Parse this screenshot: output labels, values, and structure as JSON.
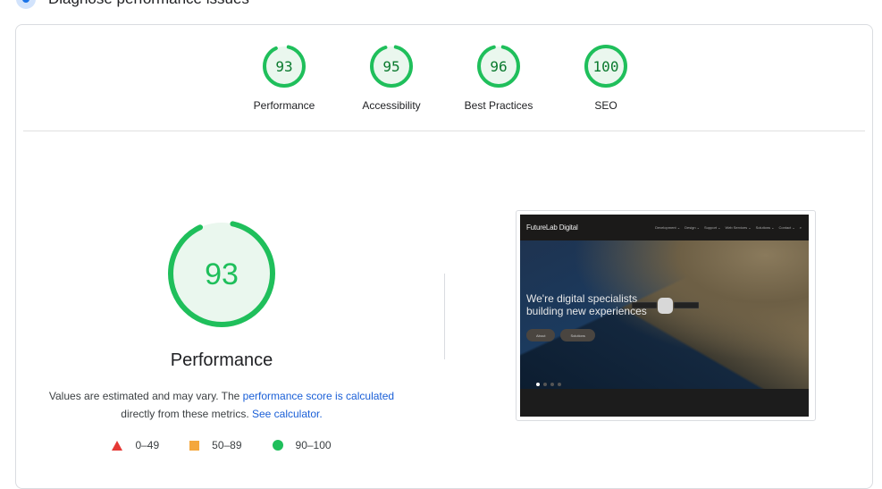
{
  "section": {
    "title": "Diagnose performance issues"
  },
  "gauges": [
    {
      "label": "Performance",
      "score": 93
    },
    {
      "label": "Accessibility",
      "score": 95
    },
    {
      "label": "Best Practices",
      "score": 96
    },
    {
      "label": "SEO",
      "score": 100
    }
  ],
  "main": {
    "score": 93,
    "label": "Performance",
    "desc_prefix": "Values are estimated and may vary. The ",
    "link1": "performance score is calculated",
    "desc_mid": "directly from these metrics. ",
    "link2": "See calculator."
  },
  "legend": [
    {
      "range": "0–49",
      "shape": "triangle",
      "color": "#e53935"
    },
    {
      "range": "50–89",
      "shape": "square",
      "color": "#f4a73c"
    },
    {
      "range": "90–100",
      "shape": "circle",
      "color": "#1fbf5b"
    }
  ],
  "colors": {
    "pass": "#1fbf5b",
    "pass_bg": "#eaf7ee",
    "pass_text": "#0a7a2e"
  },
  "screenshot": {
    "logo": "FutureLab Digital",
    "menu": [
      "Development ⌄",
      "Design ⌄",
      "Support ⌄",
      "Web Services ⌄",
      "Solutions ⌄",
      "Contact ⌄",
      "⌕"
    ],
    "headline1": "We're digital specialists",
    "headline2": "building new experiences",
    "buttons": [
      "About",
      "Solutions"
    ]
  }
}
